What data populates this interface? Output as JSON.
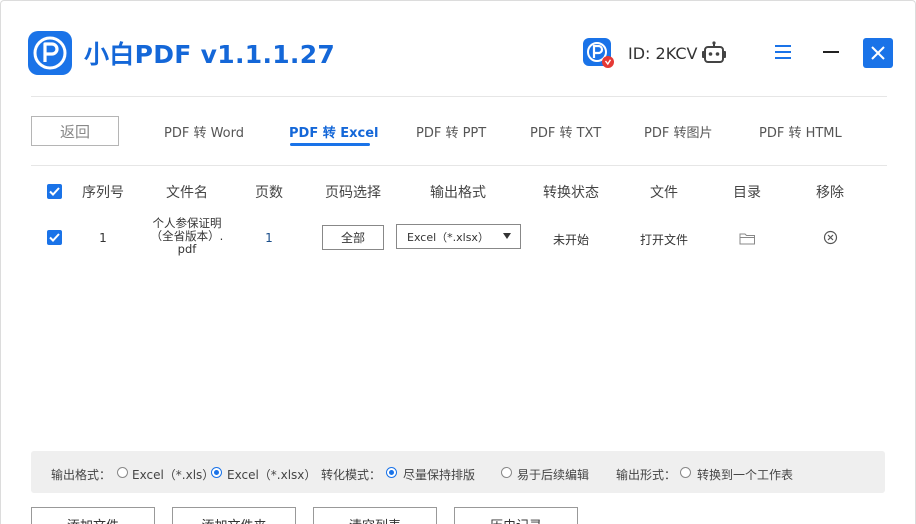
{
  "app": {
    "title": "小白PDF v1.1.1.27",
    "user_id": "ID: 2KCV",
    "accent": "#1a73e8"
  },
  "nav": {
    "back_label": "返回",
    "tabs": [
      {
        "label": "PDF 转 Word",
        "active": false
      },
      {
        "label": "PDF 转 Excel",
        "active": true
      },
      {
        "label": "PDF 转 PPT",
        "active": false
      },
      {
        "label": "PDF 转 TXT",
        "active": false
      },
      {
        "label": "PDF 转图片",
        "active": false
      },
      {
        "label": "PDF 转 HTML",
        "active": false
      }
    ]
  },
  "table": {
    "headers": [
      "序列号",
      "文件名",
      "页数",
      "页码选择",
      "输出格式",
      "转换状态",
      "文件",
      "目录",
      "移除"
    ],
    "rows": [
      {
        "index": "1",
        "filename": "个人参保证明（全省版本）.pdf",
        "filename_lines": [
          "个人参保证明",
          "（全省版本）.",
          "pdf"
        ],
        "pages": "1",
        "page_select": "全部",
        "format": "Excel（*.xlsx）",
        "status": "未开始",
        "file_action": "打开文件",
        "checked": true
      }
    ]
  },
  "options": {
    "output_format_label": "输出格式：",
    "format_xls": "Excel（*.xls）",
    "format_xlsx": "Excel（*.xlsx）",
    "mode_label": "转化模式：",
    "mode_keep": "尽量保持排版",
    "mode_edit": "易于后续编辑",
    "output_form_label": "输出形式：",
    "form_single": "转换到一个工作表"
  },
  "actions": {
    "add_file": "添加文件",
    "add_folder": "添加文件夹",
    "clear_list": "清空列表",
    "history": "历史记录"
  }
}
